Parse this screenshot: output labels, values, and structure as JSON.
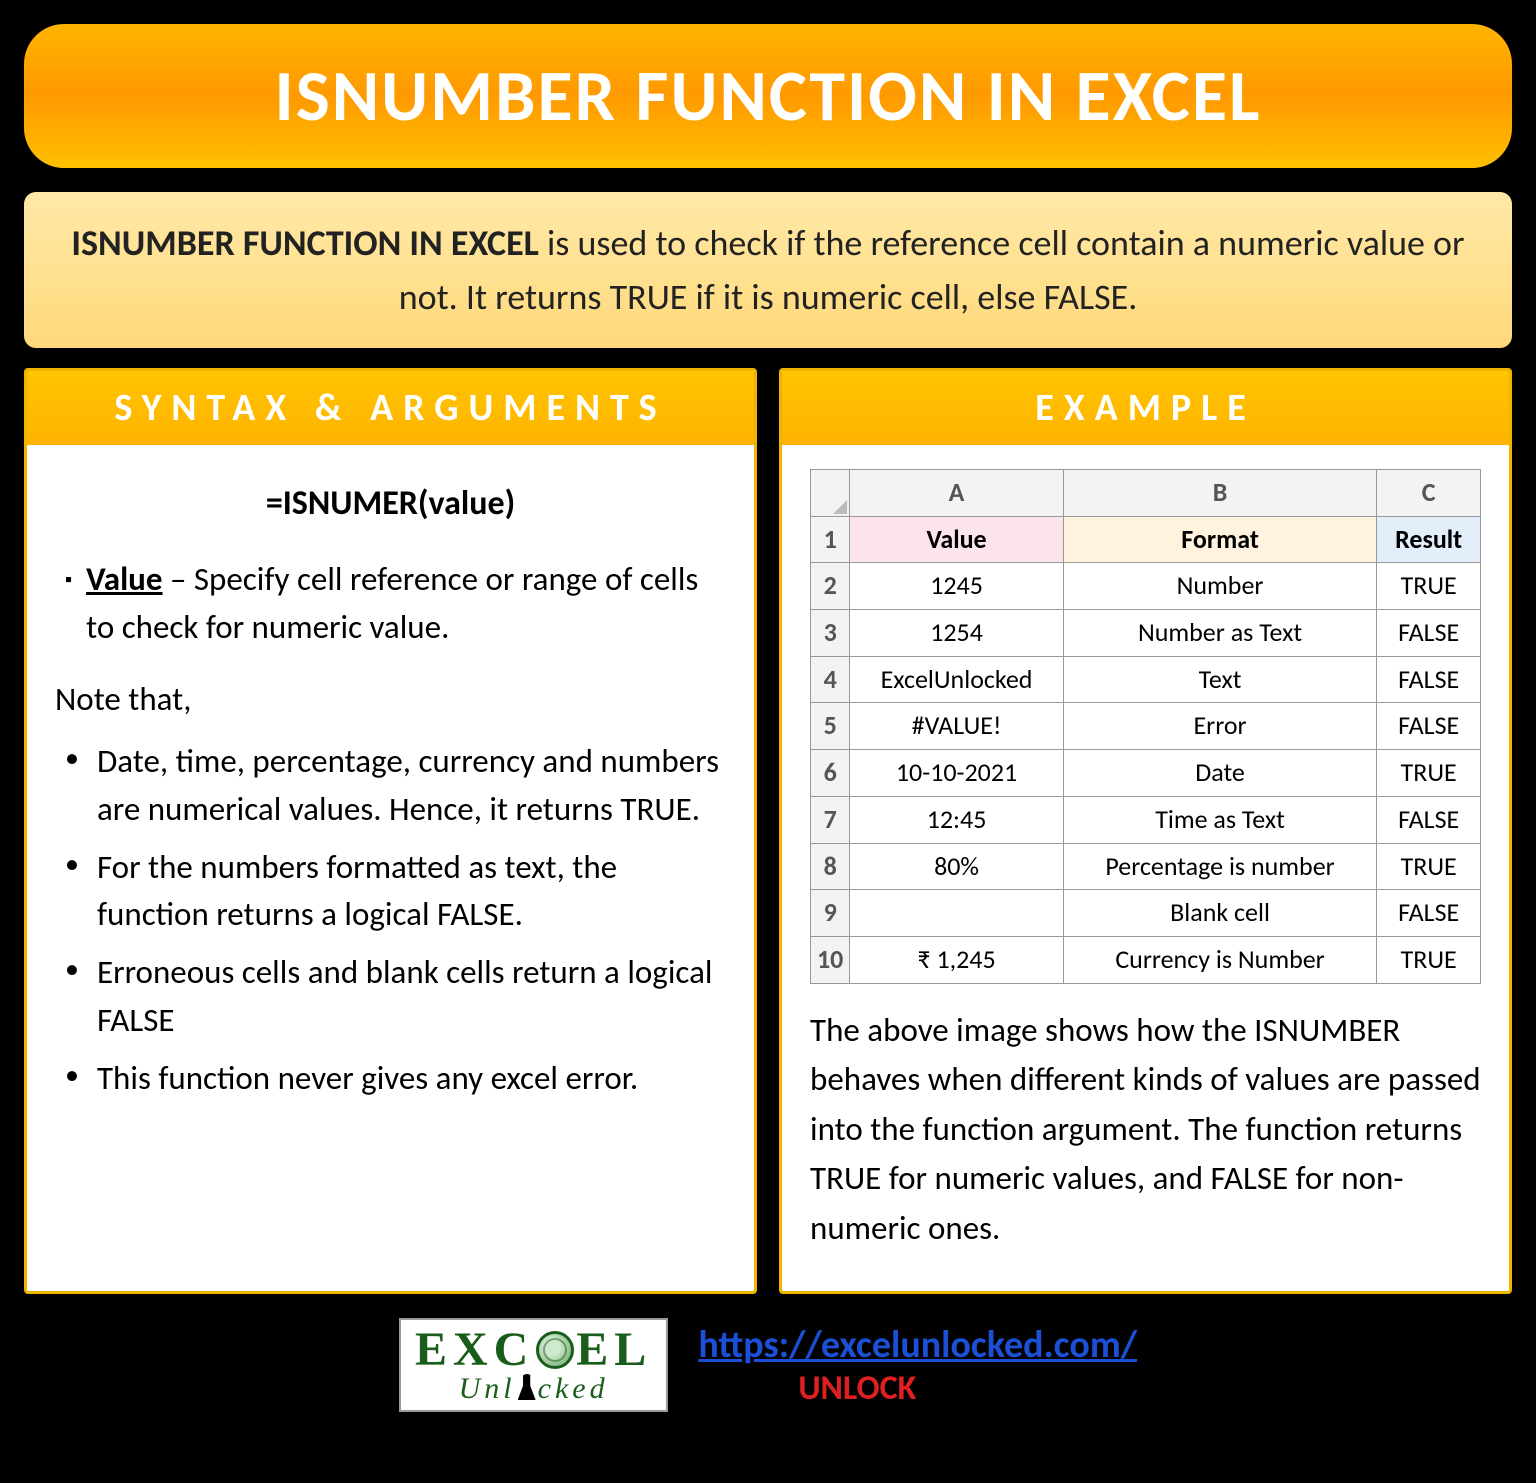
{
  "title": "ISNUMBER FUNCTION IN EXCEL",
  "description": {
    "lead": "ISNUMBER FUNCTION IN EXCEL",
    "rest": " is used to check if the reference cell contain a numeric value or not. It returns TRUE if it is numeric cell, else FALSE."
  },
  "left": {
    "header": "SYNTAX & ARGUMENTS",
    "formula": "=ISNUMER(value)",
    "arg_label": "Value",
    "arg_text": " – Specify cell reference or range of cells to check for numeric value.",
    "note_head": "Note that,",
    "notes": [
      "Date, time, percentage, currency and numbers are numerical values. Hence, it returns TRUE.",
      "For the numbers formatted as text, the function returns a logical FALSE.",
      "Erroneous cells and blank cells return a logical FALSE",
      "This function never gives any excel error."
    ]
  },
  "right": {
    "header": "EXAMPLE",
    "cols": [
      "A",
      "B",
      "C"
    ],
    "headers": {
      "value": "Value",
      "format": "Format",
      "result": "Result"
    },
    "rows": [
      {
        "n": "1",
        "value_header": true
      },
      {
        "n": "2",
        "a": "1245",
        "b": "Number",
        "c": "TRUE"
      },
      {
        "n": "3",
        "a": "1254",
        "b": "Number as Text",
        "c": "FALSE"
      },
      {
        "n": "4",
        "a": "ExcelUnlocked",
        "b": "Text",
        "c": "FALSE"
      },
      {
        "n": "5",
        "a": "#VALUE!",
        "b": "Error",
        "c": "FALSE"
      },
      {
        "n": "6",
        "a": "10-10-2021",
        "b": "Date",
        "c": "TRUE"
      },
      {
        "n": "7",
        "a": "12:45",
        "b": "Time as Text",
        "c": "FALSE"
      },
      {
        "n": "8",
        "a": "80%",
        "b": "Percentage is number",
        "c": "TRUE"
      },
      {
        "n": "9",
        "a": "",
        "b": "Blank cell",
        "c": "FALSE"
      },
      {
        "n": "10",
        "a": "₹ 1,245",
        "b": "Currency is Number",
        "c": "TRUE"
      }
    ],
    "caption": "The above image shows how the ISNUMBER behaves when different kinds of values are passed into the function argument. The function returns TRUE for numeric values, and FALSE for non-numeric ones."
  },
  "footer": {
    "logo_top_left": "EXC",
    "logo_top_right": "EL",
    "logo_bottom_left": "Unl",
    "logo_bottom_right": "cked",
    "url": "https://excelunlocked.com/",
    "unlock": "UNLOCK"
  }
}
